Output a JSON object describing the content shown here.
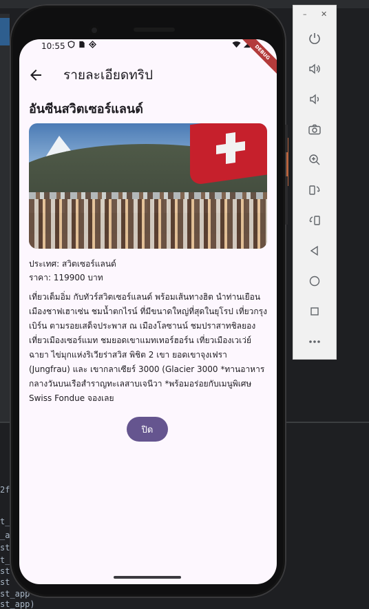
{
  "status_bar": {
    "time": "10:55",
    "left_icons": [
      "shield-icon",
      "sim-card-icon",
      "signal-strength-icon"
    ],
    "right_icons": [
      "wifi-icon",
      "cellular-signal-icon",
      "battery-icon"
    ]
  },
  "debug_banner": "DEBUG",
  "appbar": {
    "back_icon": "arrow-back-icon",
    "title": "รายละเอียดทริป"
  },
  "trip": {
    "name": "อันซีนสวิตเซอร์แลนด์",
    "country_line": "ประเทศ: สวิตเซอร์แลนด์",
    "price_line": "ราคา: 119900 บาท",
    "description": "เที่ยวเต็มอิ่ม กับทัวร์สวิตเซอร์แลนด์ พร้อมเส้นทางฮิต นำท่านเยือนเมืองชาฟเฮาเซ่น ชมน้ำตกไรน์ ที่มีขนาดใหญ่ที่สุดในยุโรป เที่ยวกรุงเบิร์น ตามรอยเสด็จประพาส ณ เมืองโลซานน์ ชมปราสาทชิลยอง เที่ยวเมืองเซอร์แมท ชมยอดเขาแมทเทอร์ฮอร์น เที่ยวเมืองเวเว่ย์ ฉายา ไข่มุกแห่งริเวียร่าสวิส พิชิต 2 เขา ยอดเขาจุงเฟรา (Jungfrau) และ เขากลาเซียร์ 3000 (Glacier 3000 *ทานอาหารกลางวันบนเรือสำราญทะเลสาบเจนีวา *พร้อมอร่อยกับเมนูพิเศษ Swiss Fondue จองเลย"
  },
  "close_button": "ปิด",
  "emulator": {
    "minimize": "–",
    "close": "✕",
    "controls": [
      "power-icon",
      "volume-up-icon",
      "volume-down-icon",
      "camera-icon",
      "zoom-in-icon",
      "rotate-left-icon",
      "rotate-right-icon",
      "back-triangle-icon",
      "home-circle-icon",
      "overview-square-icon",
      "more-icon"
    ]
  },
  "ide_fragments": [
    "2f",
    "t_",
    "_a",
    "st",
    "t_",
    "st",
    "st",
    "st_app",
    "st_app)"
  ]
}
